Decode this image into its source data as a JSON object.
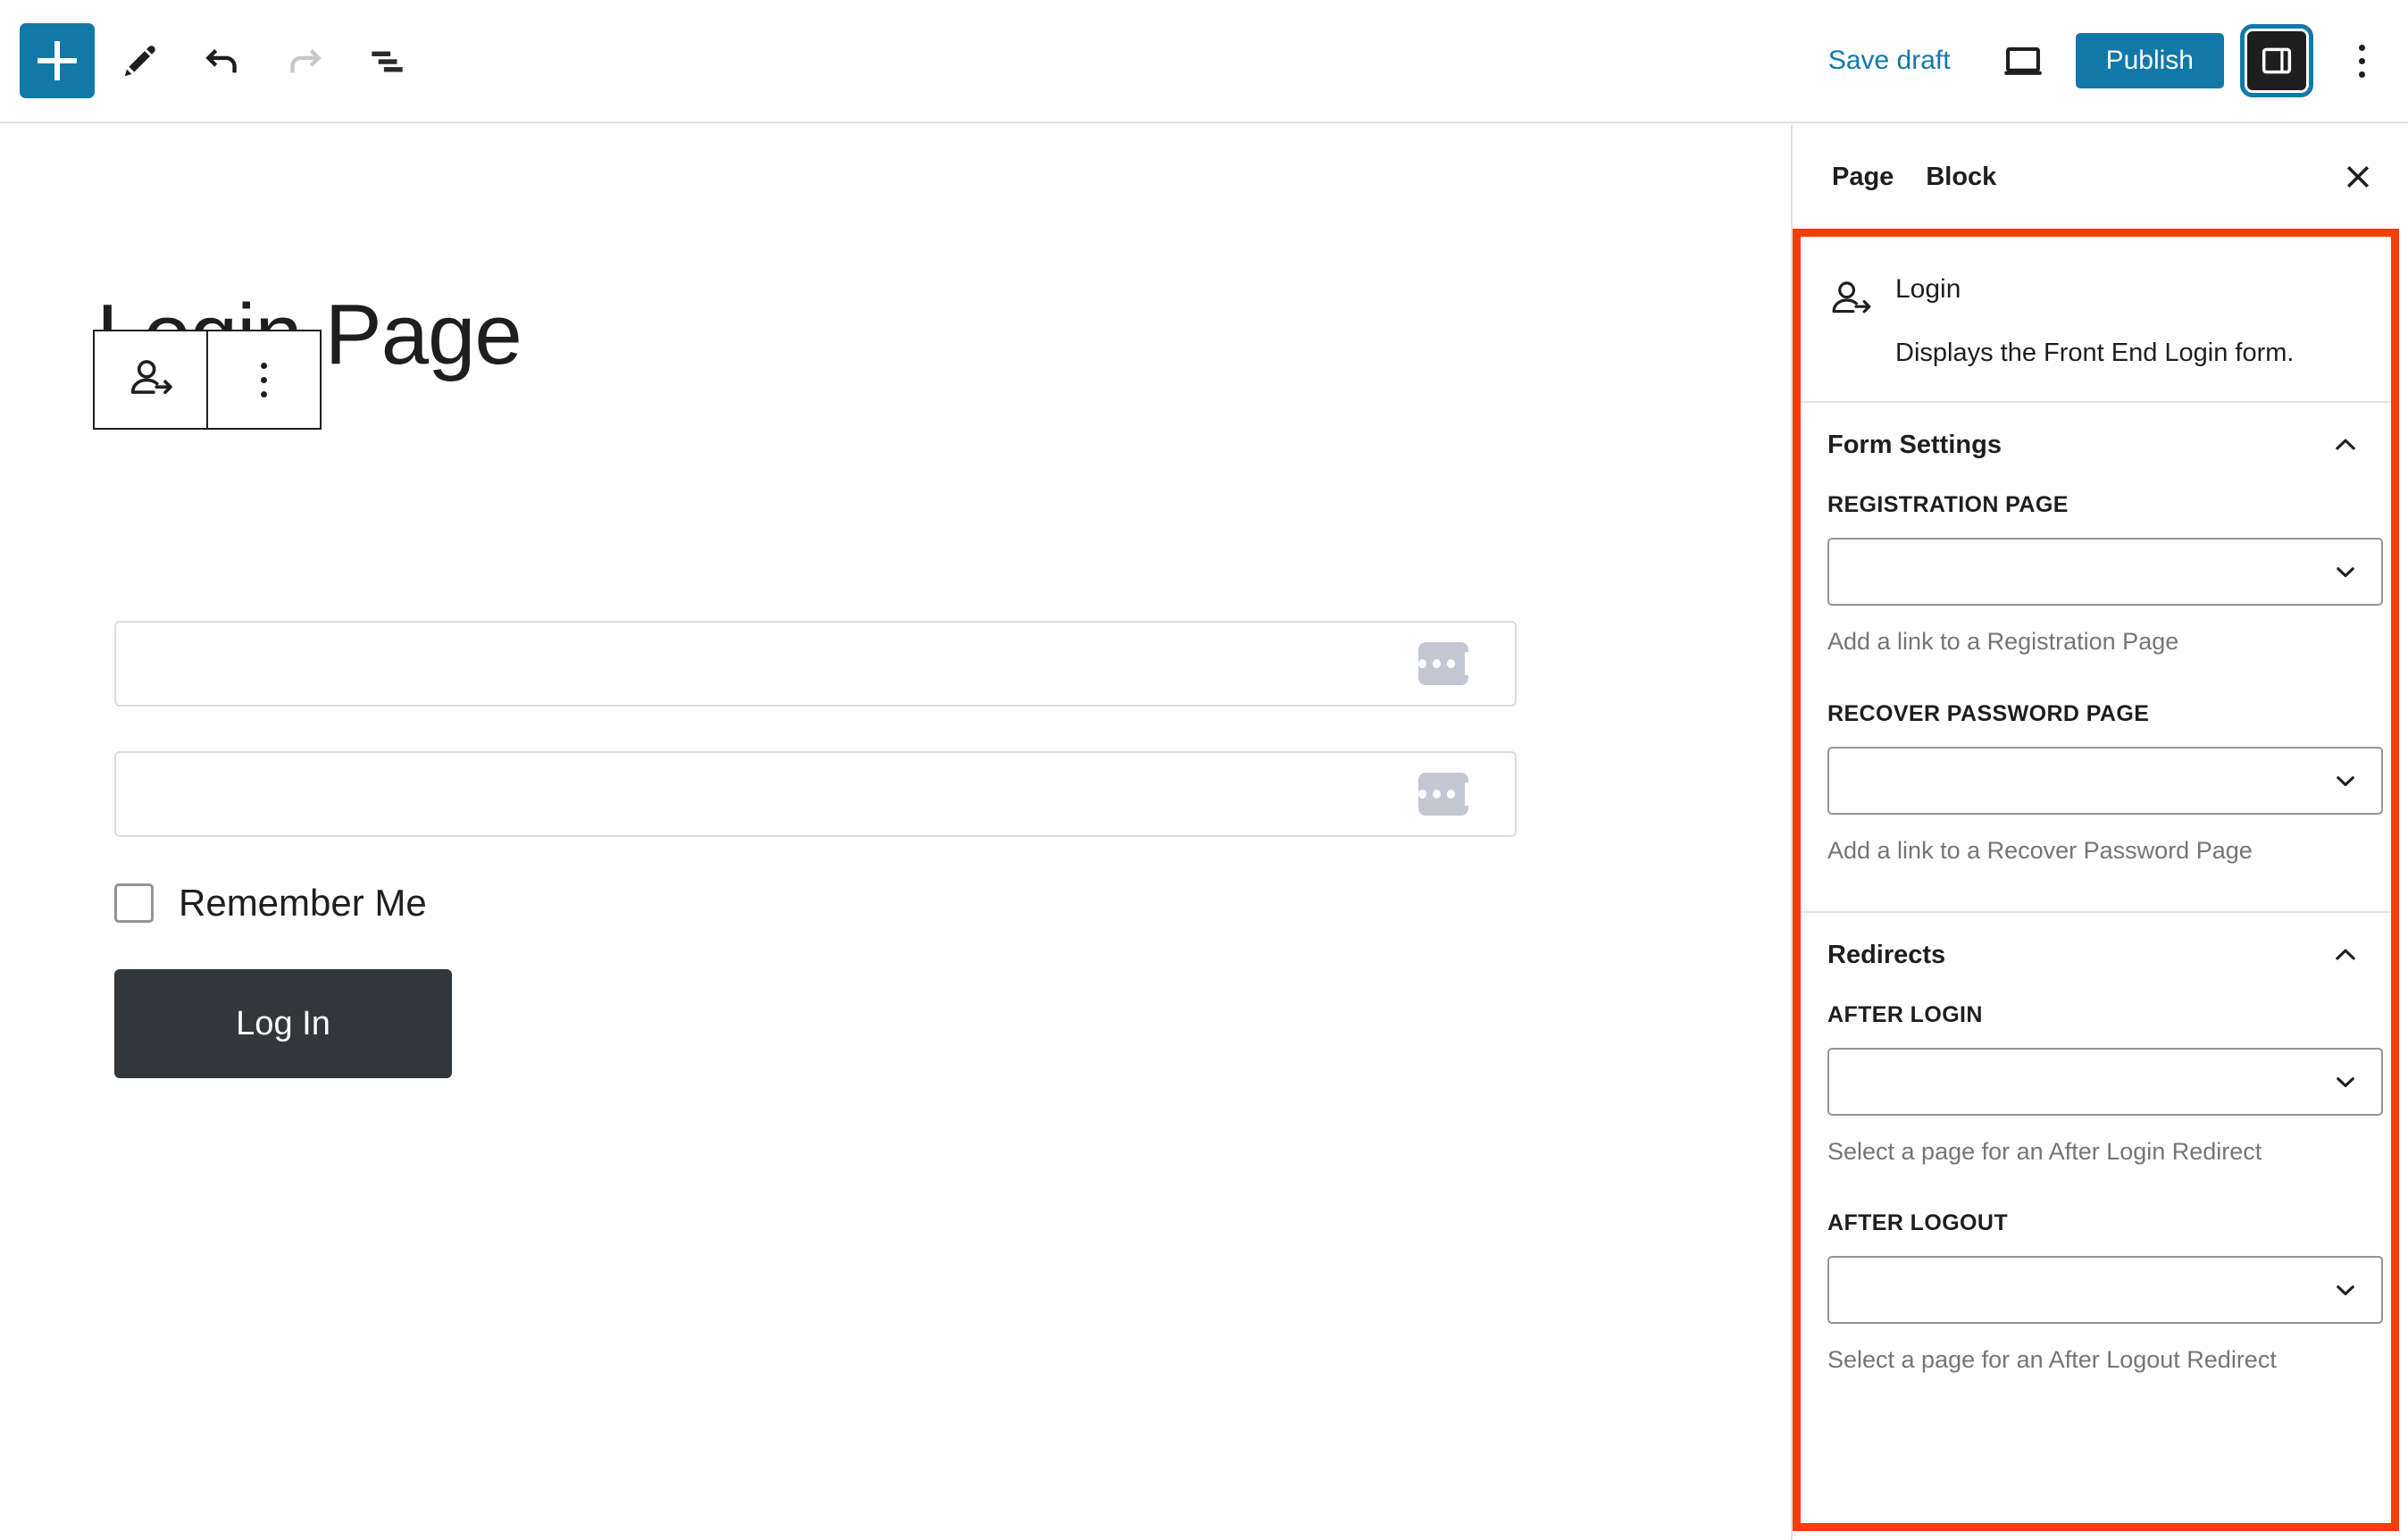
{
  "theme": {
    "accent": "#1278a8",
    "highlight": "#fa3b0a",
    "dark": "#1e1e1e",
    "button_dark": "#32373c"
  },
  "header": {
    "add_block_label": "+",
    "tools": [
      {
        "name": "add-block-icon",
        "label": "Add block"
      },
      {
        "name": "edit-pencil-icon",
        "label": "Tools"
      },
      {
        "name": "undo-icon",
        "label": "Undo"
      },
      {
        "name": "redo-icon",
        "label": "Redo"
      },
      {
        "name": "list-view-icon",
        "label": "Document overview"
      }
    ],
    "save_draft_label": "Save draft",
    "preview_icon_label": "View",
    "publish_label": "Publish",
    "settings_toggle_label": "Settings",
    "more_options_label": "Options"
  },
  "editor": {
    "post_title": "Login Page",
    "block_toolbar": {
      "block_icon_name": "login-user-arrow-icon",
      "options_label": "Options"
    },
    "login_form": {
      "username_value": "",
      "username_placeholder": "",
      "password_value": "",
      "password_placeholder": "",
      "remember_label": "Remember Me",
      "remember_checked": false,
      "submit_label": "Log In"
    }
  },
  "sidebar": {
    "tabs": [
      {
        "label": "Page",
        "active": false
      },
      {
        "label": "Block",
        "active": true
      }
    ],
    "close_label": "Close settings",
    "block_card": {
      "icon_name": "login-user-arrow-icon",
      "title": "Login",
      "description": "Displays the Front End Login form."
    },
    "panels": [
      {
        "title": "Form Settings",
        "expanded": true,
        "fields": [
          {
            "label": "REGISTRATION PAGE",
            "value": "",
            "help": "Add a link to a Registration Page"
          },
          {
            "label": "RECOVER PASSWORD PAGE",
            "value": "",
            "help": "Add a link to a Recover Password Page"
          }
        ]
      },
      {
        "title": "Redirects",
        "expanded": true,
        "fields": [
          {
            "label": "AFTER LOGIN",
            "value": "",
            "help": "Select a page for an After Login Redirect"
          },
          {
            "label": "AFTER LOGOUT",
            "value": "",
            "help": "Select a page for an After Logout Redirect"
          }
        ]
      }
    ]
  }
}
